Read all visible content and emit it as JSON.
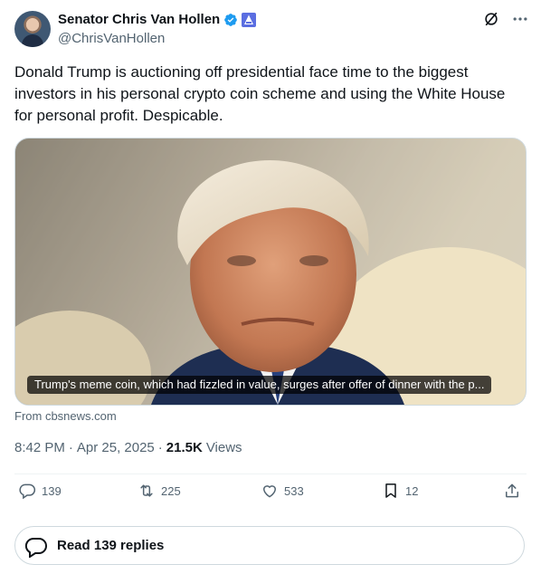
{
  "author": {
    "display_name": "Senator Chris Van Hollen",
    "handle": "@ChrisVanHollen",
    "avatar_icon": "profile-photo",
    "verified_color": "#1d9bf0",
    "gov_badge_color": "#5b6ee1"
  },
  "header_icons": [
    "grok-icon",
    "more-icon"
  ],
  "tweet": {
    "text": "Donald Trump is auctioning off presidential face time to the biggest investors in his personal crypto coin scheme and using the White House for personal profit. Despicable."
  },
  "card": {
    "caption": "Trump's meme coin, which had fizzled in value, surges after offer of dinner with the p...",
    "source": "From cbsnews.com"
  },
  "meta": {
    "time": "8:42 PM",
    "separator": "·",
    "date": "Apr 25, 2025",
    "views_count": "21.5K",
    "views_label": "Views"
  },
  "actions": {
    "replies": "139",
    "reposts": "225",
    "likes": "533",
    "bookmarks": "12"
  },
  "read_replies": {
    "label": "Read 139 replies"
  }
}
